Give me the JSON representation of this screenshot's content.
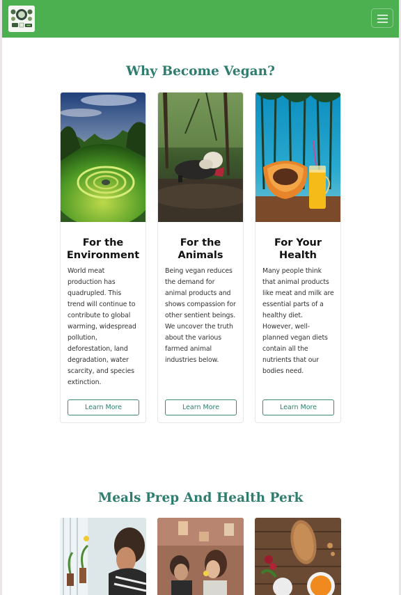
{
  "nav": {
    "logo_alt": "Vegan logo",
    "menu_icon": "hamburger-icon"
  },
  "sections": {
    "why": {
      "title": "Why Become Vegan?"
    },
    "meals": {
      "title": "Meals Prep And Health Perk"
    }
  },
  "cards": [
    {
      "title": "For the Environment",
      "text": "World meat production has quadrupled. This trend will continue to contribute to global warming, widespread pollution, deforestation, land degradation, water scarcity, and species extinction.",
      "button": "Learn More",
      "image": "environment-landscape-image"
    },
    {
      "title": "For the Animals",
      "text": "Being vegan reduces the demand for animal products and shows compassion for other sentient beings. We uncover the truth about the various farmed animal industries below.",
      "button": "Learn More",
      "image": "sheep-image"
    },
    {
      "title": "For Your Health",
      "text": "Many people think that animal products like meat and milk are essential parts of a healthy diet. However, well-planned vegan diets contain all the nutrients that our bodies need.",
      "button": "Learn More",
      "image": "papaya-juice-image"
    }
  ],
  "colors": {
    "navbar": "#4caf50",
    "heading": "#2e7d6e",
    "button_border": "#3d8b72"
  }
}
